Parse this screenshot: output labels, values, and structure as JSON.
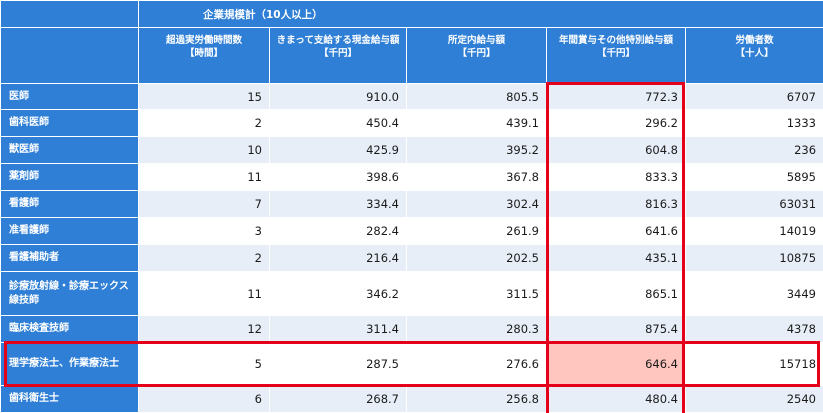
{
  "table": {
    "group_title": "企業規模計（10人以上）",
    "columns": [
      {
        "label": "超過実労働時間数",
        "unit": "【時間】"
      },
      {
        "label": "きまって支給する現金給与額",
        "unit": "【千円】"
      },
      {
        "label": "所定内給与額",
        "unit": "【千円】"
      },
      {
        "label": "年間賞与その他特別給与額",
        "unit": "【千円】"
      },
      {
        "label": "労働者数",
        "unit": "【十人】"
      }
    ],
    "rows": [
      {
        "occupation": "医師",
        "values": [
          "15",
          "910.0",
          "805.5",
          "772.3",
          "6707"
        ]
      },
      {
        "occupation": "歯科医師",
        "values": [
          "2",
          "450.4",
          "439.1",
          "296.2",
          "1333"
        ]
      },
      {
        "occupation": "獣医師",
        "values": [
          "10",
          "425.9",
          "395.2",
          "604.8",
          "236"
        ]
      },
      {
        "occupation": "薬剤師",
        "values": [
          "11",
          "398.6",
          "367.8",
          "833.3",
          "5895"
        ]
      },
      {
        "occupation": "看護師",
        "values": [
          "7",
          "334.4",
          "302.4",
          "816.3",
          "63031"
        ]
      },
      {
        "occupation": "准看護師",
        "values": [
          "3",
          "282.4",
          "261.9",
          "641.6",
          "14019"
        ]
      },
      {
        "occupation": "看護補助者",
        "values": [
          "2",
          "216.4",
          "202.5",
          "435.1",
          "10875"
        ]
      },
      {
        "occupation": "診療放射線・診療エックス線技師",
        "values": [
          "11",
          "346.2",
          "311.5",
          "865.1",
          "3449"
        ]
      },
      {
        "occupation": "臨床検査技師",
        "values": [
          "12",
          "311.4",
          "280.3",
          "875.4",
          "4378"
        ]
      },
      {
        "occupation": "理学療法士、作業療法士",
        "values": [
          "5",
          "287.5",
          "276.6",
          "646.4",
          "15718"
        ]
      },
      {
        "occupation": "歯科衛生士",
        "values": [
          "6",
          "268.7",
          "256.8",
          "480.4",
          "2540"
        ]
      }
    ]
  },
  "highlight_color": "#e4001b",
  "highlight_cell_color": "#ffc6c0",
  "header_color": "#2f7fd6"
}
